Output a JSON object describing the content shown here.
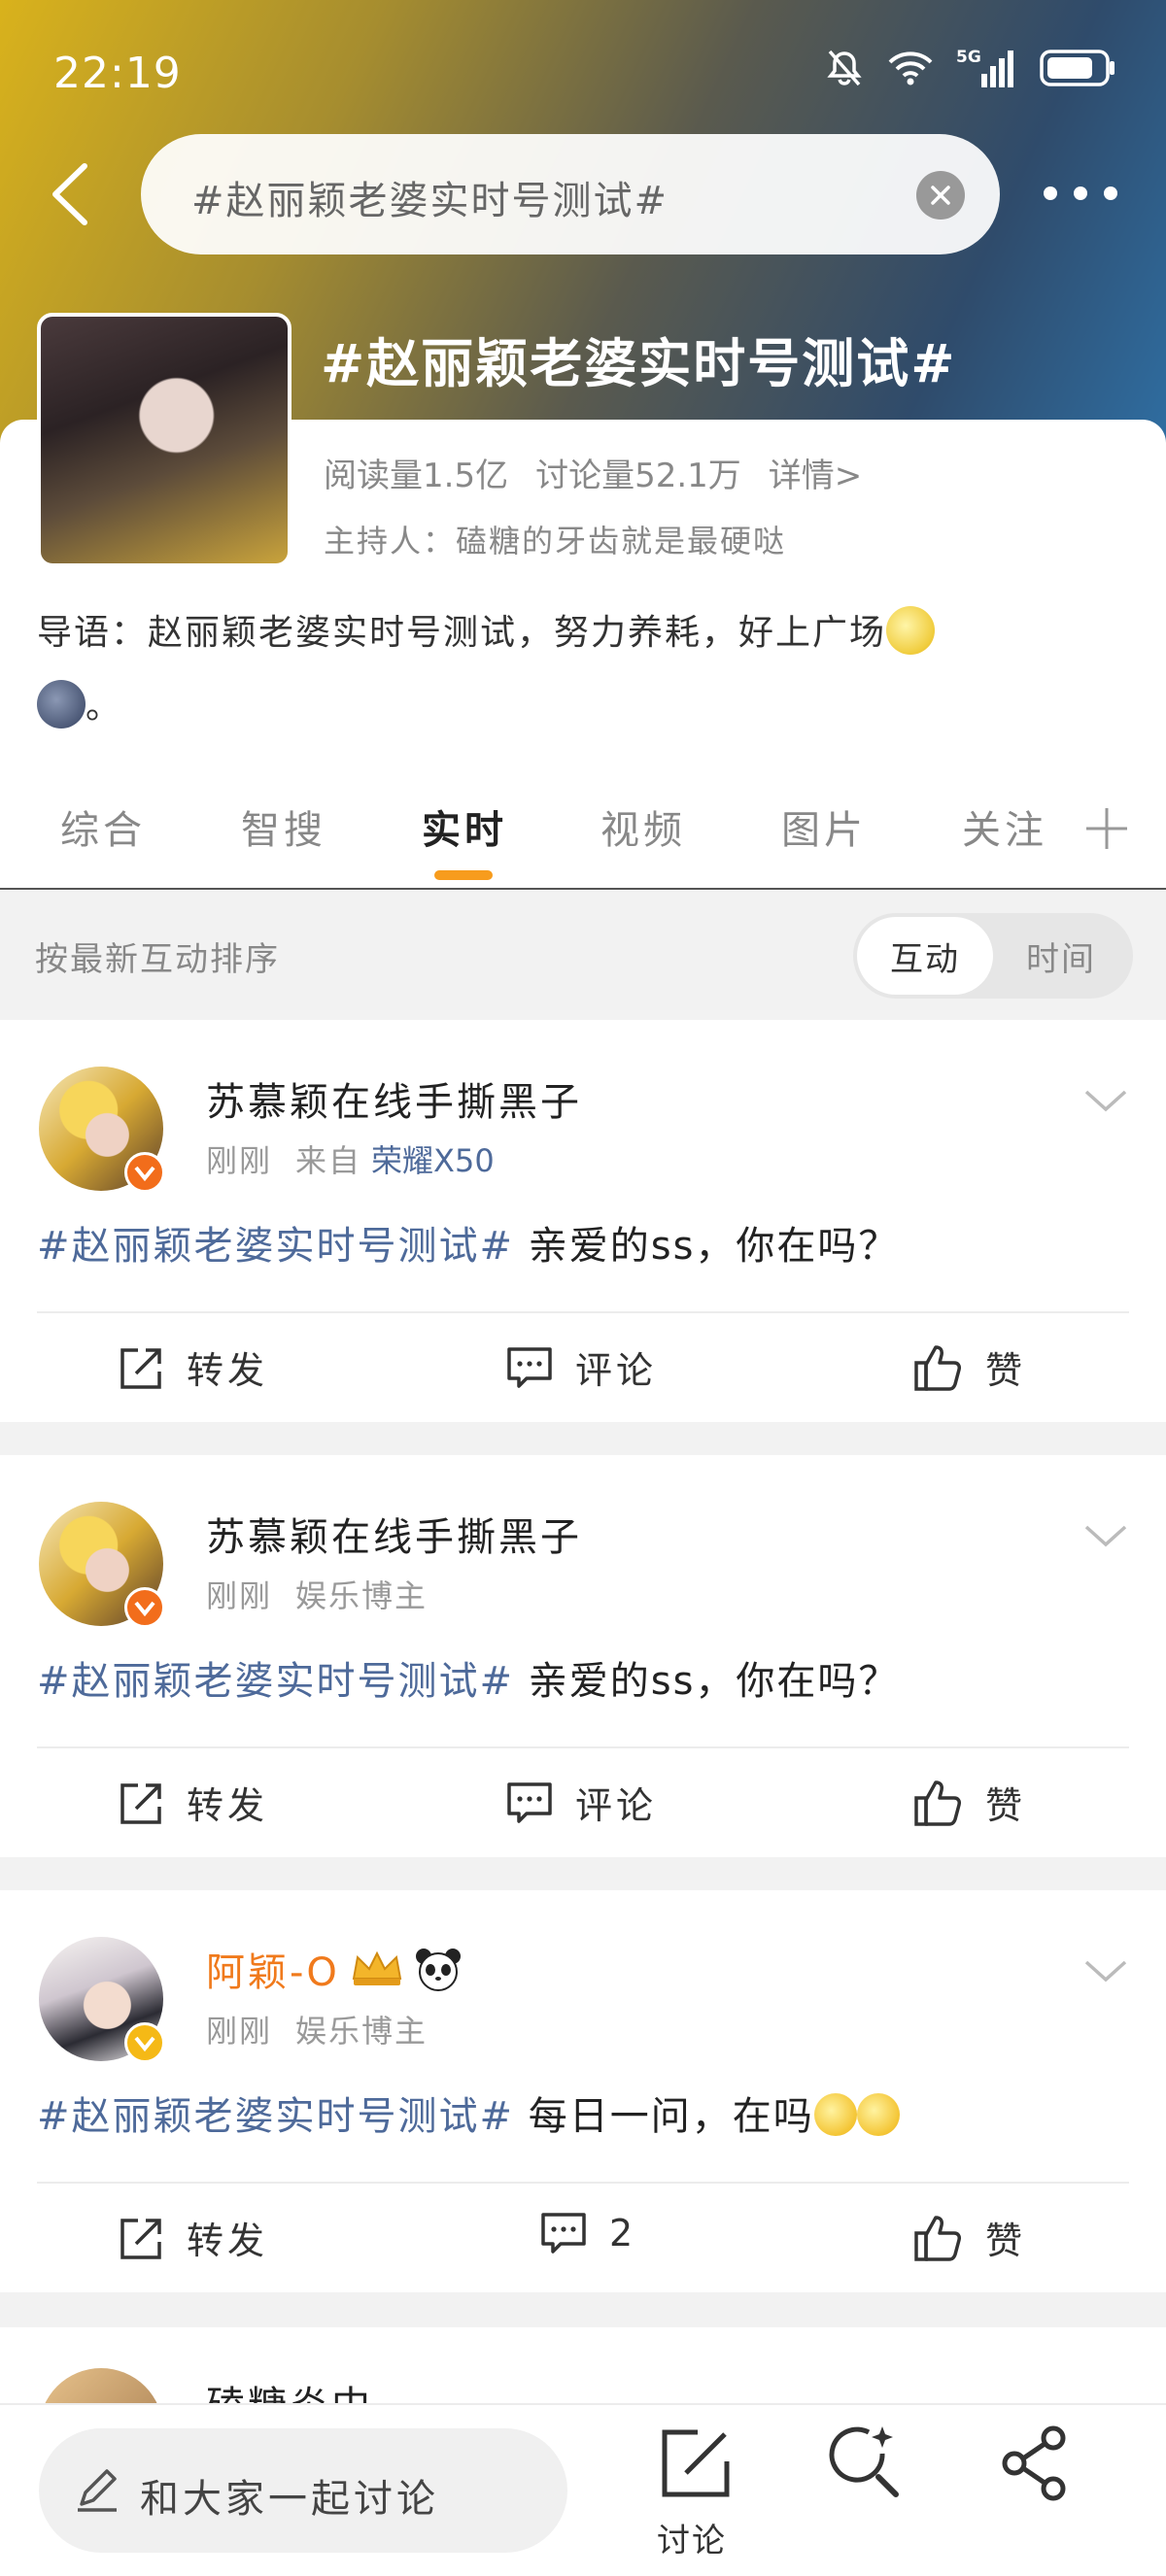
{
  "status_bar": {
    "time": "22:19",
    "network": "5G"
  },
  "search": {
    "query": "#赵丽颖老婆实时号测试#"
  },
  "topic": {
    "title": "#赵丽颖老婆实时号测试#",
    "reads": "阅读量1.5亿",
    "discussions": "讨论量52.1万",
    "details": "详情>",
    "host": "主持人：磕糖的牙齿就是最硬哒",
    "intro": "导语：赵丽颖老婆实时号测试，努力养耗，好上广场",
    "intro_end": "。"
  },
  "tabs": [
    "综合",
    "智搜",
    "实时",
    "视频",
    "图片",
    "关注"
  ],
  "active_tab": "实时",
  "sort": {
    "label": "按最新互动排序",
    "option_on": "互动",
    "option_off": "时间"
  },
  "posts": [
    {
      "user": "苏慕颖在线手撕黑子",
      "time": "刚刚",
      "source_prefix": "来自",
      "source": "荣耀X50",
      "tag": "#赵丽颖老婆实时号测试#",
      "text": " 亲爱的ss，你在吗？",
      "repost": "转发",
      "comment": "评论",
      "like": "赞"
    },
    {
      "user": "苏慕颖在线手撕黑子",
      "time": "刚刚",
      "role": "娱乐博主",
      "tag": "#赵丽颖老婆实时号测试#",
      "text": " 亲爱的ss，你在吗？",
      "repost": "转发",
      "comment": "评论",
      "like": "赞"
    },
    {
      "user": "阿颖-O",
      "time": "刚刚",
      "role": "娱乐博主",
      "tag": "#赵丽颖老婆实时号测试#",
      "text": " 每日一问，在吗",
      "repost": "转发",
      "comment": "2",
      "like": "赞"
    }
  ],
  "partial_post": {
    "user": "磕糖炎中"
  },
  "bottom": {
    "compose": "和大家一起讨论",
    "discuss": "讨论"
  },
  "colors": {
    "accent": "#f79c1d",
    "link": "#4e6a9a",
    "orange_name": "#f07a1c"
  }
}
